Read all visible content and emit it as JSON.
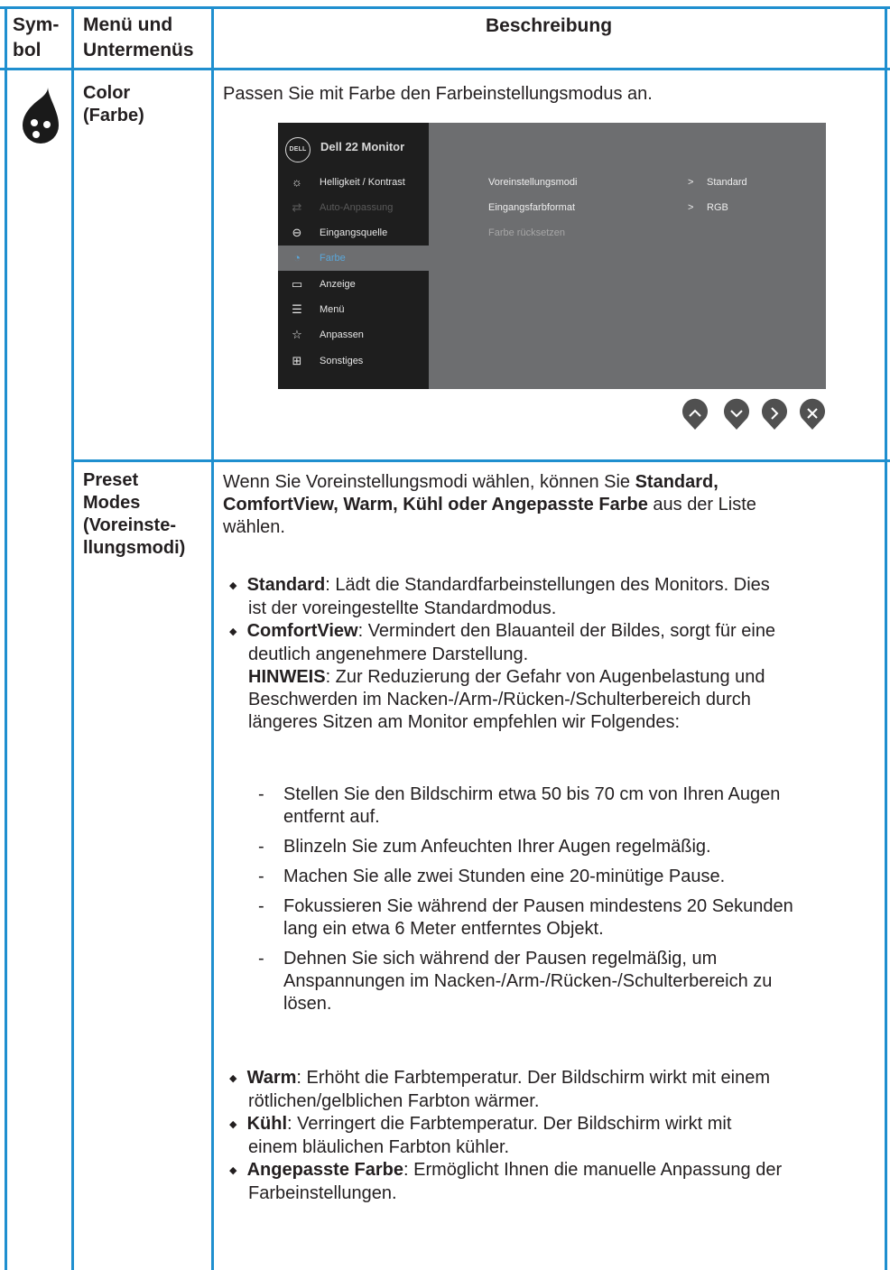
{
  "header": {
    "col_symbol": [
      "Sym-",
      "bol"
    ],
    "col_menu": [
      "Menü und",
      "Untermenüs"
    ],
    "col_desc": "Beschreibung"
  },
  "color_row": {
    "symbol_icon": "color-drop-icon",
    "menu_name": [
      "Color",
      "(Farbe)"
    ],
    "description": "Passen Sie mit Farbe den Farbeinstellungsmodus an."
  },
  "osd": {
    "logo": "DELL",
    "title": "Dell 22 Monitor",
    "items": [
      {
        "label": "Helligkeit / Kontrast",
        "icon": "brightness-icon",
        "glyph": "☼",
        "state": "normal"
      },
      {
        "label": "Auto-Anpassung",
        "icon": "auto-adjust-icon",
        "glyph": "⇄",
        "state": "dim"
      },
      {
        "label": "Eingangsquelle",
        "icon": "input-source-icon",
        "glyph": "⊖",
        "state": "normal"
      },
      {
        "label": "Farbe",
        "icon": "color-icon",
        "glyph": "◔",
        "state": "active"
      },
      {
        "label": "Anzeige",
        "icon": "display-icon",
        "glyph": "▭",
        "state": "normal"
      },
      {
        "label": "Menü",
        "icon": "menu-icon",
        "glyph": "☰",
        "state": "normal"
      },
      {
        "label": "Anpassen",
        "icon": "star-icon",
        "glyph": "☆",
        "state": "normal"
      },
      {
        "label": "Sonstiges",
        "icon": "others-icon",
        "glyph": "⊞",
        "state": "normal"
      }
    ],
    "settings": [
      {
        "label": "Voreinstellungsmodi",
        "value": "Standard",
        "arrow": ">"
      },
      {
        "label": "Eingangsfarbformat",
        "value": "RGB",
        "arrow": ">"
      },
      {
        "label": "Farbe rücksetzen",
        "value": "",
        "arrow": ""
      }
    ],
    "nav_buttons": [
      "up-icon",
      "down-icon",
      "right-icon",
      "close-icon"
    ]
  },
  "preset_row": {
    "menu_name": [
      "Preset",
      "Modes",
      "(Voreinste-",
      "llungsmodi)"
    ],
    "intro_lines": [
      [
        "Wenn Sie Voreinstellungsmodi wählen, können Sie ",
        "Standard,"
      ],
      [
        "ComfortView, Warm, Kühl oder Angepasste Farbe",
        " aus der Liste"
      ],
      [
        "wählen."
      ]
    ],
    "bullets": [
      {
        "term": "Standard",
        "lines": [
          ": Lädt die Standardfarbeinstellungen des Monitors. Dies",
          "ist der voreingestellte Standardmodus."
        ]
      },
      {
        "term": "ComfortView",
        "lines": [
          ": Vermindert den Blauanteil der Bildes, sorgt für eine",
          "deutlich angenehmere Darstellung."
        ]
      }
    ],
    "note": {
      "term": "HINWEIS",
      "lines": [
        ": Zur Reduzierung der Gefahr von Augenbelastung und",
        "Beschwerden im Nacken-/Arm-/Rücken-/Schulterbereich durch",
        "längeres Sitzen am Monitor empfehlen wir Folgendes:"
      ]
    },
    "tips": [
      [
        "Stellen Sie den Bildschirm etwa 50 bis 70 cm von Ihren Augen",
        "entfernt auf."
      ],
      [
        "Blinzeln Sie zum Anfeuchten Ihrer Augen regelmäßig."
      ],
      [
        "Machen Sie alle zwei Stunden eine 20-minütige Pause."
      ],
      [
        "Fokussieren Sie während der Pausen mindestens 20 Sekunden",
        "lang ein etwa 6 Meter entferntes Objekt."
      ],
      [
        "Dehnen Sie sich während der Pausen regelmäßig, um",
        "Anspannungen im Nacken-/Arm-/Rücken-/Schulterbereich zu",
        "lösen."
      ]
    ],
    "bullets2": [
      {
        "term": "Warm",
        "lines": [
          ": Erhöht die Farbtemperatur. Der Bildschirm wirkt mit einem",
          "rötlichen/gelblichen Farbton wärmer."
        ]
      },
      {
        "term": "Kühl",
        "lines": [
          ": Verringert die Farbtemperatur. Der Bildschirm wirkt mit",
          "einem bläulichen Farbton kühler."
        ]
      },
      {
        "term": "Angepasste Farbe",
        "lines": [
          ": Ermöglicht Ihnen die manuelle Anpassung der",
          "Farbeinstellungen."
        ]
      }
    ]
  }
}
